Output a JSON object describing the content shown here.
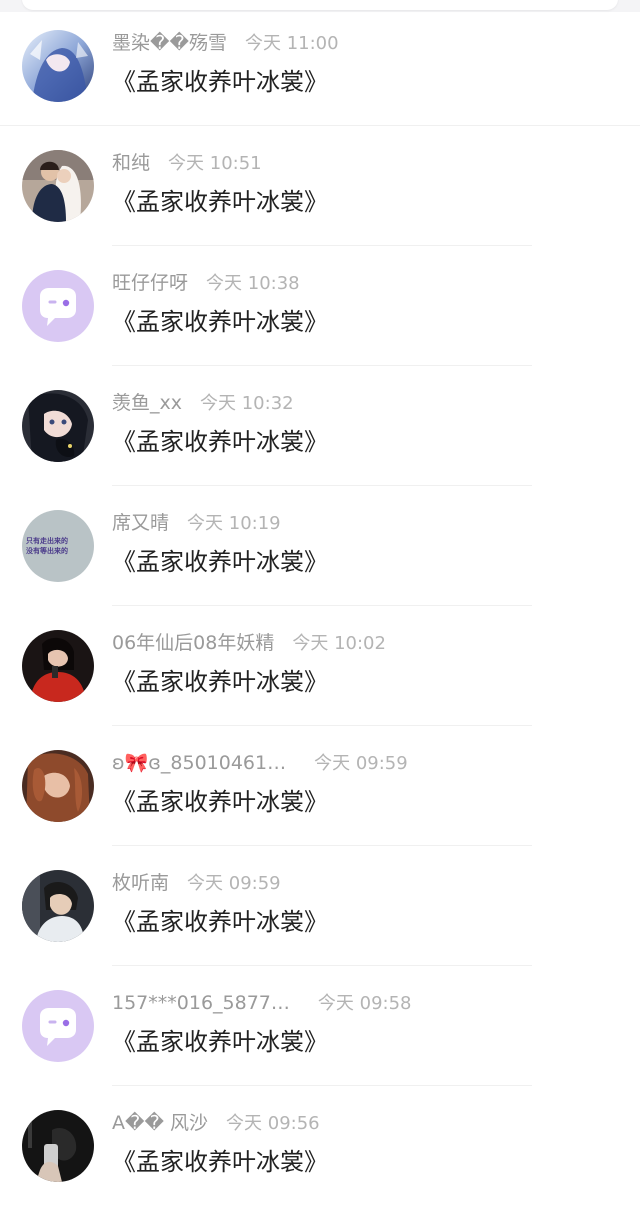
{
  "comments": [
    {
      "user": "墨染��殇雪",
      "time": "今天  11:00",
      "text": "《孟家收养叶冰裳》",
      "avatar": "anime-blue-hair"
    },
    {
      "user": "和纯",
      "time": "今天  10:51",
      "text": "《孟家收养叶冰裳》",
      "avatar": "wedding-couple"
    },
    {
      "user": "旺仔仔呀",
      "time": "今天  10:38",
      "text": "《孟家收养叶冰裳》",
      "avatar": "default-chat"
    },
    {
      "user": "羡鱼_xx",
      "time": "今天  10:32",
      "text": "《孟家收养叶冰裳》",
      "avatar": "anime-girl-cat"
    },
    {
      "user": "席又晴",
      "time": "今天  10:19",
      "text": "《孟家收养叶冰裳》",
      "avatar": "text-image",
      "avatar_lines": [
        "只有走出来的",
        "没有等出来的"
      ]
    },
    {
      "user": "06年仙后08年妖精",
      "time": "今天  10:02",
      "text": "《孟家收养叶冰裳》",
      "avatar": "singer-red"
    },
    {
      "user": "ʚ🎀ɞ_85010461…",
      "time": "今天  09:59",
      "text": "《孟家收养叶冰裳》",
      "avatar": "girl-auburn-hair"
    },
    {
      "user": "枚听南",
      "time": "今天  09:59",
      "text": "《孟家收养叶冰裳》",
      "avatar": "boy-portrait"
    },
    {
      "user": "157***016_5877…",
      "time": "今天  09:58",
      "text": "《孟家收养叶冰裳》",
      "avatar": "default-chat"
    },
    {
      "user": "A�� 风沙",
      "time": "今天  09:56",
      "text": "《孟家收养叶冰裳》",
      "avatar": "dark-phone"
    }
  ],
  "colors": {
    "username": "#9a9a9a",
    "time": "#b4b4b4",
    "message": "#222222",
    "default_avatar_bg": "#d9c8f3"
  }
}
